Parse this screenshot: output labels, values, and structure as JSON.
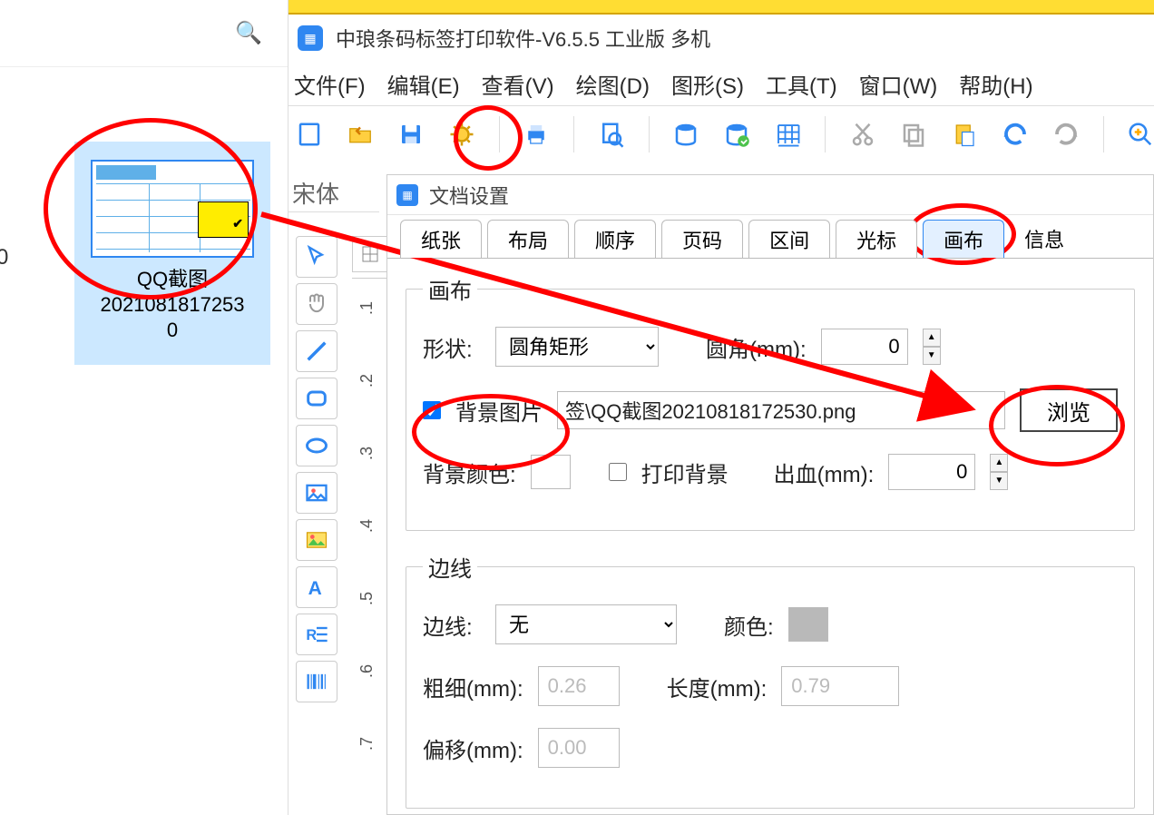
{
  "explorer": {
    "thumb_label_line1": "QQ截图",
    "thumb_label_line2": "2021081817253",
    "thumb_label_line3": "0",
    "axis_zero": "0"
  },
  "app": {
    "title": "中琅条码标签打印软件-V6.5.5 工业版 多机"
  },
  "menu": {
    "file": "文件(F)",
    "edit": "编辑(E)",
    "view": "查看(V)",
    "draw": "绘图(D)",
    "shape": "图形(S)",
    "tool": "工具(T)",
    "window": "窗口(W)",
    "help": "帮助(H)"
  },
  "fontstrip": "宋体",
  "panel": {
    "title": "文档设置"
  },
  "tabs": [
    "纸张",
    "布局",
    "顺序",
    "页码",
    "区间",
    "光标",
    "画布",
    "信息"
  ],
  "canvas": {
    "legend": "画布",
    "shape_label": "形状:",
    "shape_value": "圆角矩形",
    "radius_label": "圆角(mm):",
    "radius_value": "0",
    "bgimg_label": "背景图片",
    "bgimg_path": "签\\QQ截图20210818172530.png",
    "browse": "浏览",
    "bgcolor_label": "背景颜色:",
    "printbg_label": "打印背景",
    "bleed_label": "出血(mm):",
    "bleed_value": "0"
  },
  "border": {
    "legend": "边线",
    "line_label": "边线:",
    "line_value": "无",
    "color_label": "颜色:",
    "thick_label": "粗细(mm):",
    "thick_value": "0.26",
    "length_label": "长度(mm):",
    "length_value": "0.79",
    "offset_label": "偏移(mm):",
    "offset_value": "0.00"
  },
  "ruler_ticks": [
    ".1",
    ".2",
    ".3",
    ".4",
    ".5",
    ".6",
    ".7"
  ]
}
